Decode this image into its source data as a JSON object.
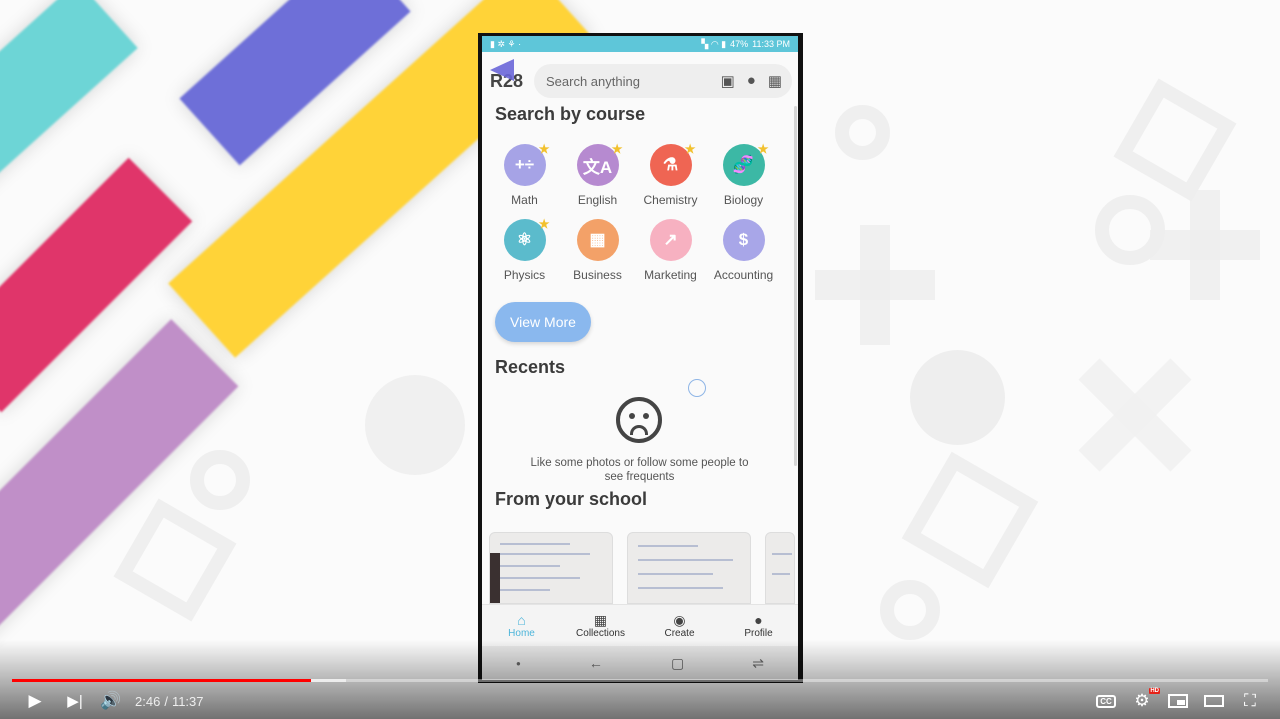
{
  "phone": {
    "status": {
      "left_icons": "▮ ✲ ⚘ ·",
      "battery": "47%",
      "time": "11:33 PM"
    },
    "logo": "R28",
    "search_placeholder": "Search anything",
    "search_icons": [
      "save-icon",
      "person-icon",
      "building-icon"
    ],
    "course_section_title": "Search by course",
    "courses": [
      {
        "label": "Math",
        "icon": "math-icon",
        "glyph": "+÷",
        "color": "#a6a3e6",
        "starred": true
      },
      {
        "label": "English",
        "icon": "translate-icon",
        "glyph": "文A",
        "color": "#b68ad0",
        "starred": true
      },
      {
        "label": "Chemistry",
        "icon": "flask-icon",
        "glyph": "⚗",
        "color": "#ef6553",
        "starred": true
      },
      {
        "label": "Biology",
        "icon": "dna-icon",
        "glyph": "🧬",
        "color": "#3cb8a5",
        "starred": true
      },
      {
        "label": "Physics",
        "icon": "atom-icon",
        "glyph": "⚛",
        "color": "#5bbbcc",
        "starred": true
      },
      {
        "label": "Business",
        "icon": "building-icon",
        "glyph": "▦",
        "color": "#f3a168",
        "starred": false
      },
      {
        "label": "Marketing",
        "icon": "trend-icon",
        "glyph": "↗",
        "color": "#f7b1c1",
        "starred": false
      },
      {
        "label": "Accounting",
        "icon": "dollar-icon",
        "glyph": "$",
        "color": "#a8a6e8",
        "starred": false
      }
    ],
    "view_more_label": "View More",
    "recents_title": "Recents",
    "empty_text": "Like some photos or follow some people to see frequents",
    "school_title": "From your school",
    "nav": [
      {
        "label": "Home",
        "icon": "home-icon",
        "glyph": "⌂",
        "active": true
      },
      {
        "label": "Collections",
        "icon": "grid-icon",
        "glyph": "▦",
        "active": false
      },
      {
        "label": "Create",
        "icon": "camera-icon",
        "glyph": "◉",
        "active": false
      },
      {
        "label": "Profile",
        "icon": "person-icon",
        "glyph": "●",
        "active": false
      }
    ]
  },
  "player": {
    "current_time": "2:46",
    "separator": "/",
    "duration": "11:37",
    "played_fraction": 0.238,
    "loaded_fraction": 0.266,
    "hd_badge": "HD"
  }
}
